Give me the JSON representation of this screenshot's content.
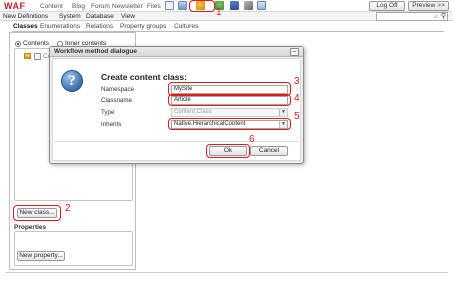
{
  "app": {
    "logo": "WAF",
    "top_nav": [
      "Content",
      "Blog",
      "Forum",
      "Newsletter",
      "Files"
    ],
    "logoff_label": "Log Off",
    "preview_label": "Preview >>"
  },
  "toolbar_icons": [
    "mail-icon",
    "image-icon",
    "workflow-icon",
    "user-icon",
    "flag-icon",
    "tools-icon",
    "trash-icon"
  ],
  "menubar": [
    "New Definitions",
    "System",
    "Database",
    "View"
  ],
  "search": {
    "value": ""
  },
  "tabs": [
    "Classes",
    "Enumerations",
    "Relations",
    "Property groups",
    "Cultures"
  ],
  "left_pane": {
    "radio_contents": "Contents",
    "radio_inner": "Inner contents",
    "tree_item": "Co",
    "new_class_label": "New class...",
    "properties_title": "Properties",
    "new_property_label": "New property..."
  },
  "dialog": {
    "title": "Workflow method dialogue",
    "close_glyph": "–",
    "heading": "Create content class:",
    "fields": [
      {
        "label": "Namespace",
        "value": "MySite"
      },
      {
        "label": "Classname",
        "value": "Article"
      },
      {
        "label": "Type",
        "value": "Content Class"
      },
      {
        "label": "Inherits",
        "value": "Native.HierarchicalContent"
      }
    ],
    "ok_label": "Ok",
    "cancel_label": "Cancel"
  },
  "annotations": [
    "1",
    "2",
    "3",
    "4",
    "5",
    "6"
  ],
  "colors": {
    "annotation": "#e21b1b",
    "logo": "#c0202a",
    "icon_blue": "#3c6fad"
  }
}
